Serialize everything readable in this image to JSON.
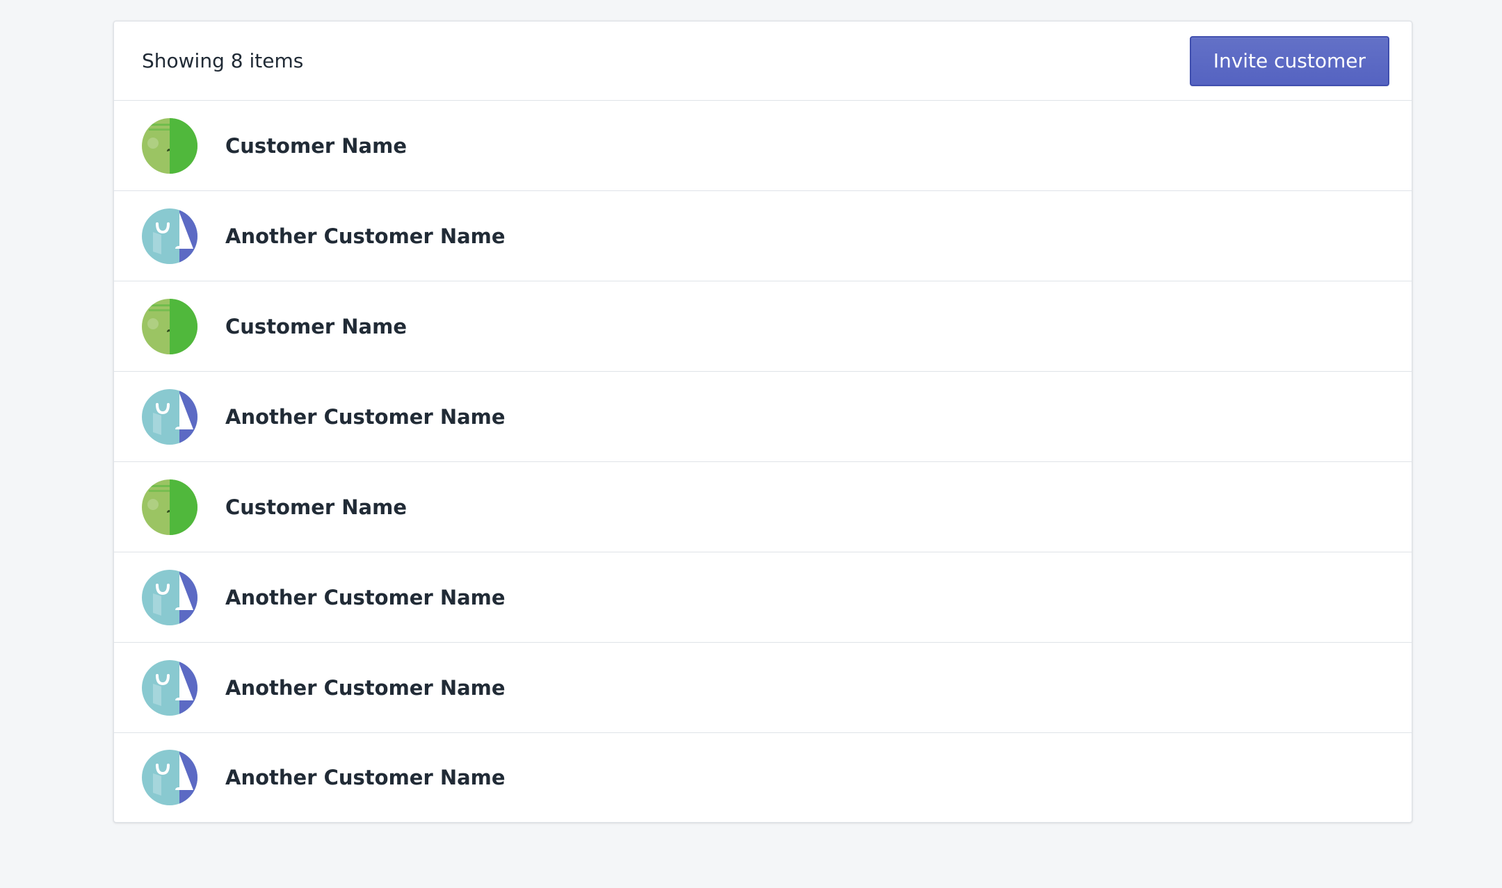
{
  "header": {
    "count_text": "Showing 8 items",
    "invite_label": "Invite customer"
  },
  "colors": {
    "accent": "#5c6ac4",
    "green_light": "#9bc463",
    "green_dark": "#50b83c",
    "teal": "#89c9d0",
    "indigo": "#5c6ac4"
  },
  "customers": [
    {
      "name": "Customer Name",
      "avatar": "green-avatar-icon"
    },
    {
      "name": "Another Customer Name",
      "avatar": "teal-avatar-icon"
    },
    {
      "name": "Customer Name",
      "avatar": "green-avatar-icon"
    },
    {
      "name": "Another Customer Name",
      "avatar": "teal-avatar-icon"
    },
    {
      "name": "Customer Name",
      "avatar": "green-avatar-icon"
    },
    {
      "name": "Another Customer Name",
      "avatar": "teal-avatar-icon"
    },
    {
      "name": "Another Customer Name",
      "avatar": "teal-avatar-icon"
    },
    {
      "name": "Another Customer Name",
      "avatar": "teal-avatar-icon"
    }
  ]
}
